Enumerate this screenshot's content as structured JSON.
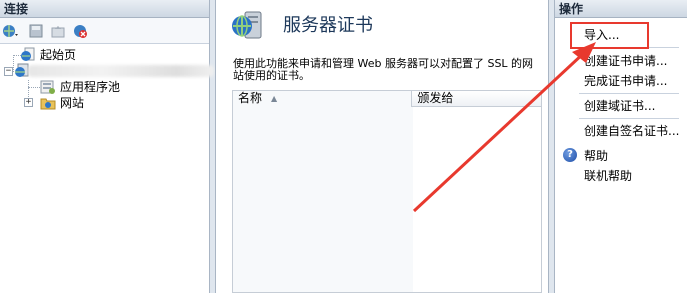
{
  "left_pane": {
    "header": "连接",
    "tree": {
      "start_page": "起始页",
      "app_pools": "应用程序池",
      "sites": "网站"
    }
  },
  "center": {
    "title": "服务器证书",
    "description": "使用此功能来申请和管理 Web 服务器可以对配置了 SSL 的网站使用的证书。",
    "columns": [
      "名称",
      "颁发给"
    ]
  },
  "actions": {
    "header": "操作",
    "items": [
      "导入...",
      "创建证书申请...",
      "完成证书申请...",
      "创建域证书...",
      "创建自签名证书...",
      "帮助",
      "联机帮助"
    ]
  },
  "colors": {
    "highlight": "#e8392e",
    "arrow": "#e8392e",
    "title": "#1e395b"
  }
}
